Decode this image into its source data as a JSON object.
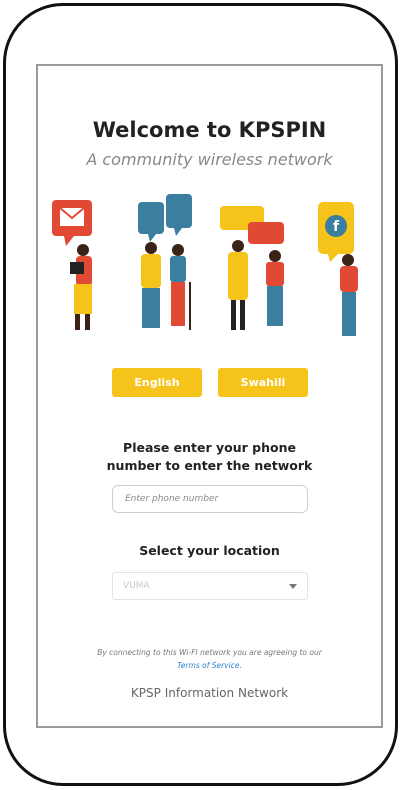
{
  "header": {
    "title": "Welcome to KPSPIN",
    "subtitle": "A community wireless network"
  },
  "languages": {
    "english": "English",
    "swahili": "Swahili"
  },
  "phone": {
    "prompt_line1": "Please enter your phone",
    "prompt_line2": "number to enter the network",
    "placeholder": "Enter phone number"
  },
  "location": {
    "label": "Select your location",
    "selected": "VUMA"
  },
  "terms": {
    "text": "By connecting to this Wi-FI network you are agreeing to our",
    "link": "Terms of Service."
  },
  "footer": {
    "text": "KPSP Information Network"
  },
  "colors": {
    "accent_yellow": "#f6c31a",
    "link_blue": "#2f7ecb",
    "bubble_red": "#e04a35",
    "bubble_blue": "#3a7ea0"
  }
}
